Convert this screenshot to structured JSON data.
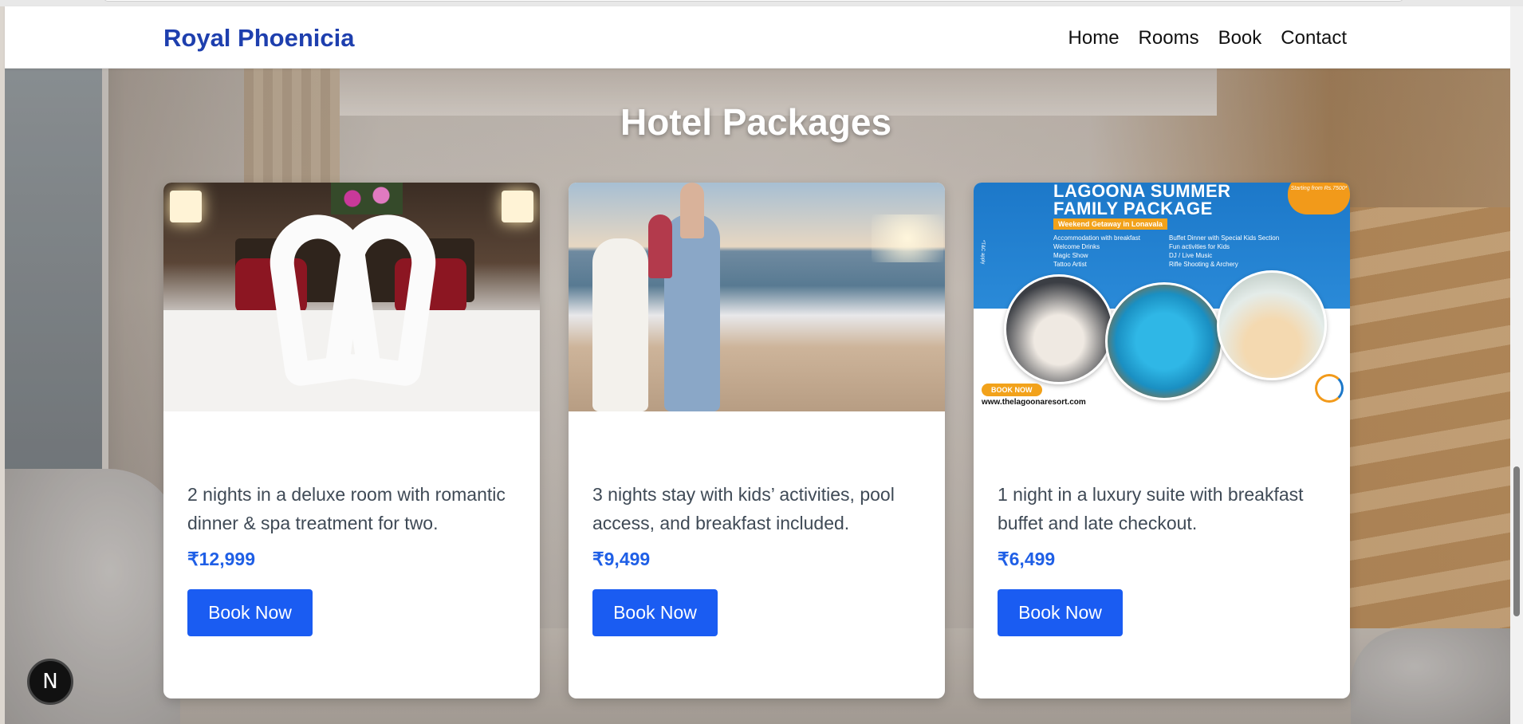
{
  "navbar": {
    "brand": "Royal Phoenicia",
    "links": [
      "Home",
      "Rooms",
      "Book",
      "Contact"
    ]
  },
  "section": {
    "title": "Hotel Packages"
  },
  "cards": [
    {
      "image": "bedroom-towel-swans-image",
      "description": "2 nights in a deluxe room with romantic dinner & spa treatment for two.",
      "price": "₹12,999",
      "button": "Book Now"
    },
    {
      "image": "family-beach-image",
      "description": "3 nights stay with kids’ activities, pool access, and breakfast included.",
      "price": "₹9,499",
      "button": "Book Now"
    },
    {
      "image": "lagoona-promo-image",
      "description": "1 night in a luxury suite with breakfast buffet and late checkout.",
      "price": "₹6,499",
      "button": "Book Now",
      "promo": {
        "title_line1": "LAGOONA SUMMER",
        "title_line2": "FAMILY PACKAGE",
        "tag": "Weekend Getaway in Lonavala",
        "list_left": [
          "Accommodation with breakfast",
          "Welcome Drinks",
          "Magic Show",
          "Tattoo Artist"
        ],
        "list_right": [
          "Buffet Dinner with Special Kids Section",
          "Fun activities for Kids",
          "DJ / Live Music",
          "Rifle Shooting & Archery"
        ],
        "badge": "Starting from Rs.7500*",
        "cta": "BOOK NOW",
        "url": "www.thelagoonaresort.com",
        "side_note": "*T&C apply"
      }
    }
  ],
  "dev_badge": "N",
  "colors": {
    "brand": "#1e3fae",
    "price": "#1f5fe6",
    "button": "#1a5cf2",
    "promo_blue": "#1c78c9",
    "promo_orange": "#f2a21b"
  }
}
